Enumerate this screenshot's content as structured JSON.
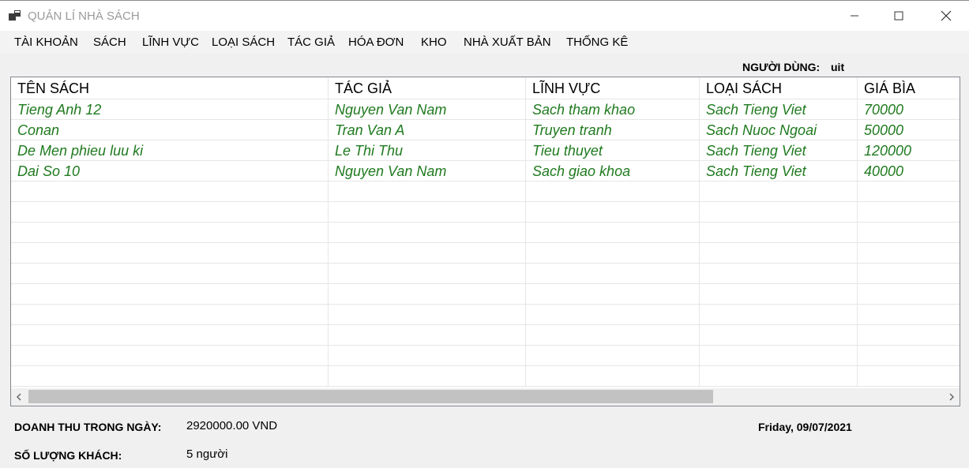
{
  "window": {
    "title": "QUẢN LÍ NHÀ SÁCH",
    "controls": [
      "minimize",
      "maximize",
      "close"
    ]
  },
  "menu": {
    "items": [
      "TÀI KHOẢN",
      "SÁCH",
      "LĨNH VỰC",
      "LOẠI SÁCH",
      "TÁC GIẢ",
      "HÓA ĐƠN",
      "KHO",
      "NHÀ XUẤT BẢN",
      "THỐNG KÊ"
    ]
  },
  "user": {
    "label": "NGƯỜI DÙNG:",
    "name": "uit"
  },
  "table": {
    "columns": [
      "TÊN SÁCH",
      "TÁC GIẢ",
      "LĨNH VỰC",
      "LOẠI SÁCH",
      "GIÁ BÌA"
    ],
    "rows": [
      [
        "Tieng Anh 12",
        "Nguyen Van Nam",
        "Sach tham khao",
        "Sach Tieng Viet",
        "70000"
      ],
      [
        "Conan",
        "Tran Van A",
        "Truyen tranh",
        "Sach Nuoc Ngoai",
        "50000"
      ],
      [
        "De Men phieu luu ki",
        "Le Thi Thu",
        "Tieu thuyet",
        "Sach Tieng Viet",
        "120000"
      ],
      [
        "Dai So 10",
        "Nguyen Van Nam",
        "Sach giao khoa",
        "Sach Tieng Viet",
        "40000"
      ]
    ],
    "text_color": "#1f7a1f"
  },
  "footer": {
    "revenue_label": "DOANH THU TRONG NGÀY:",
    "revenue_value": "2920000.00 VND",
    "date": "Friday, 09/07/2021",
    "customers_label": "SỐ LƯỢNG KHÁCH:",
    "customers_value": "5 người"
  }
}
